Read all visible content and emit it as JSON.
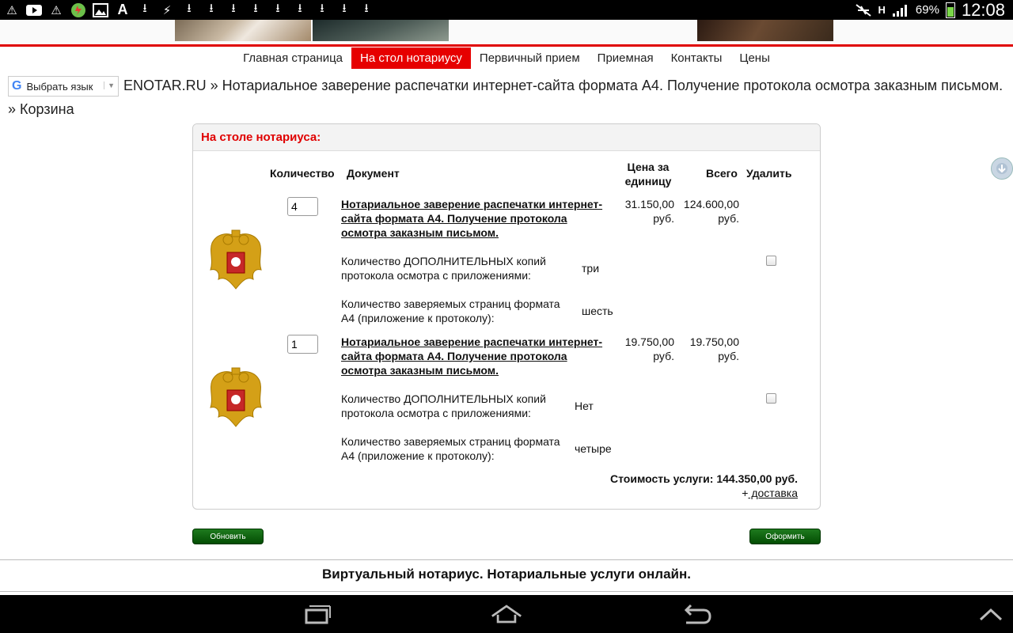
{
  "status_bar": {
    "battery": "69%",
    "time": "12:08",
    "network_type": "H",
    "left_icons": [
      "alert-icon",
      "youtube-icon",
      "warning-icon",
      "security-app-icon",
      "image-icon",
      "font-icon",
      "download-icon",
      "flash-icon",
      "download-icon",
      "download-icon",
      "download-icon",
      "download-icon",
      "download-icon",
      "download-icon",
      "download-icon",
      "download-icon",
      "download-icon"
    ]
  },
  "nav": {
    "items": [
      {
        "label": "Главная страница",
        "active": false
      },
      {
        "label": "На стол нотариусу",
        "active": true
      },
      {
        "label": "Первичный прием",
        "active": false
      },
      {
        "label": "Приемная",
        "active": false
      },
      {
        "label": "Контакты",
        "active": false
      },
      {
        "label": "Цены",
        "active": false
      }
    ]
  },
  "translate": {
    "label": "Выбрать язык",
    "logo": "G"
  },
  "breadcrumb": "ENOTAR.RU » Нотариальное заверение распечатки интернет-сайта формата А4. Получение протокола осмотра заказным письмом. » Корзина",
  "cart": {
    "title": "На столе нотариуса:",
    "headers": {
      "quantity": "Количество",
      "document": "Документ",
      "unit_price": "Цена за единицу",
      "total": "Всего",
      "delete": "Удалить"
    },
    "items": [
      {
        "quantity": "4",
        "document": "Нотариальное заверение распечатки интернет-сайта формата А4. Получение протокола осмотра заказным письмом.",
        "unit_price": "31.150,00 руб.",
        "total": "124.600,00 руб.",
        "options": [
          {
            "label": "Количество ДОПОЛНИТЕЛЬНЫХ копий протокола осмотра с приложениями:",
            "value": "три"
          },
          {
            "label": "Количество заверяемых страниц формата А4 (приложение к протоколу):",
            "value": "шесть"
          }
        ]
      },
      {
        "quantity": "1",
        "document": "Нотариальное заверение распечатки интернет-сайта формата А4. Получение протокола осмотра заказным письмом.",
        "unit_price": "19.750,00 руб.",
        "total": "19.750,00 руб.",
        "options": [
          {
            "label": "Количество ДОПОЛНИТЕЛЬНЫХ копий протокола осмотра с приложениями:",
            "value": "Нет"
          },
          {
            "label": "Количество заверяемых страниц формата А4 (приложение к протоколу):",
            "value": "четыре"
          }
        ]
      }
    ],
    "total_line": "Стоимость услуги: 144.350,00 руб.",
    "delivery_prefix": "+",
    "delivery_link": " доставка"
  },
  "buttons": {
    "update": "Обновить",
    "checkout": "Оформить"
  },
  "footer": "Виртуальный нотариус. Нотариальные услуги онлайн."
}
